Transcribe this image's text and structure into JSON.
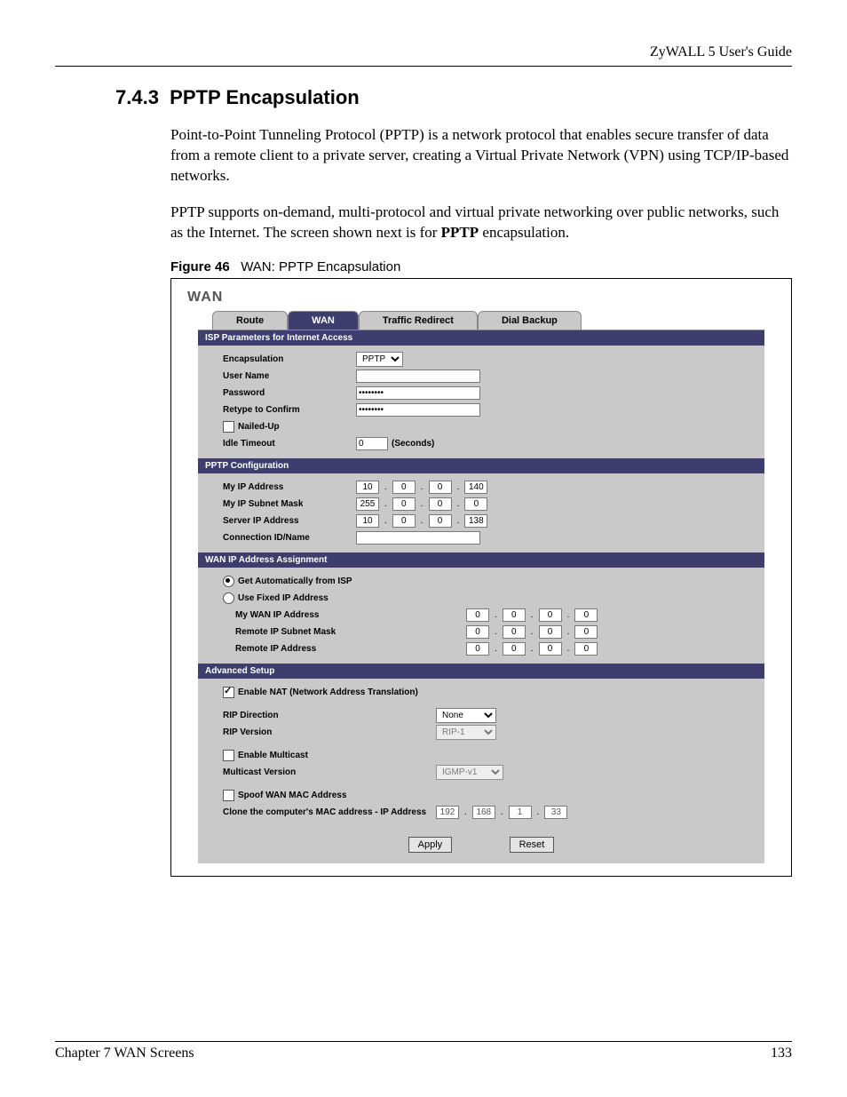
{
  "header": {
    "guide": "ZyWALL 5 User's Guide"
  },
  "section": {
    "number": "7.4.3",
    "title": "PPTP Encapsulation",
    "para1": "Point-to-Point Tunneling Protocol (PPTP) is a network protocol that enables secure transfer of data from a remote client to a private server, creating a Virtual Private Network (VPN) using TCP/IP-based networks.",
    "para2_a": "PPTP supports on-demand, multi-protocol and virtual private networking over public networks, such as the Internet. The screen shown next is for ",
    "para2_bold": "PPTP",
    "para2_b": " encapsulation."
  },
  "figure": {
    "label": "Figure 46",
    "caption": "WAN: PPTP Encapsulation"
  },
  "shot": {
    "title": "WAN",
    "tabs": [
      "Route",
      "WAN",
      "Traffic Redirect",
      "Dial Backup"
    ],
    "active_tab": 1,
    "sec_isp": "ISP Parameters for Internet Access",
    "encapsulation_label": "Encapsulation",
    "encapsulation_value": "PPTP",
    "username_label": "User Name",
    "username_value": "",
    "password_label": "Password",
    "password_value": "********",
    "retype_label": "Retype to Confirm",
    "retype_value": "********",
    "nailed_label": "Nailed-Up",
    "idle_label": "Idle Timeout",
    "idle_value": "0",
    "idle_unit": "(Seconds)",
    "sec_pptp": "PPTP Configuration",
    "myip_label": "My IP Address",
    "myip": [
      "10",
      "0",
      "0",
      "140"
    ],
    "mymask_label": "My IP Subnet Mask",
    "mymask": [
      "255",
      "0",
      "0",
      "0"
    ],
    "server_label": "Server IP Address",
    "server": [
      "10",
      "0",
      "0",
      "138"
    ],
    "conn_label": "Connection ID/Name",
    "conn_value": "",
    "sec_wan": "WAN IP Address Assignment",
    "auto_label": "Get Automatically from ISP",
    "fixed_label": "Use Fixed IP Address",
    "mywan_label": "My WAN IP Address",
    "mywan": [
      "0",
      "0",
      "0",
      "0"
    ],
    "remmask_label": "Remote IP Subnet Mask",
    "remmask": [
      "0",
      "0",
      "0",
      "0"
    ],
    "remip_label": "Remote IP Address",
    "remip": [
      "0",
      "0",
      "0",
      "0"
    ],
    "sec_adv": "Advanced Setup",
    "nat_label": "Enable NAT (Network Address Translation)",
    "ripdir_label": "RIP Direction",
    "ripdir_value": "None",
    "ripver_label": "RIP Version",
    "ripver_value": "RIP-1",
    "multi_label": "Enable Multicast",
    "multiver_label": "Multicast Version",
    "multiver_value": "IGMP-v1",
    "spoof_label": "Spoof WAN MAC Address",
    "clone_label": "Clone the computer's MAC address - IP Address",
    "clone": [
      "192",
      "168",
      "1",
      "33"
    ],
    "apply": "Apply",
    "reset": "Reset"
  },
  "footer": {
    "chapter": "Chapter 7 WAN Screens",
    "page": "133"
  }
}
